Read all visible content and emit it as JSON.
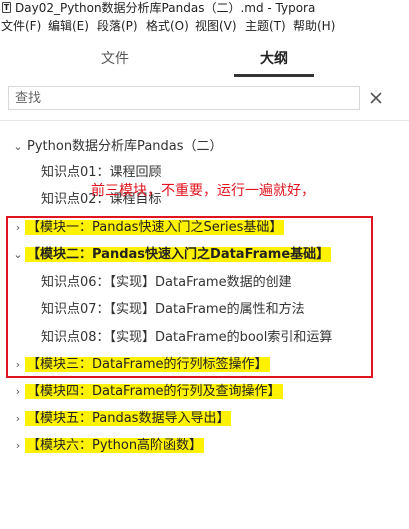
{
  "window": {
    "title": "Day02_Python数据分析库Pandas（二）.md - Typora",
    "app_icon": "T"
  },
  "menu": [
    "文件(F)",
    "编辑(E)",
    "段落(P)",
    "格式(O)",
    "视图(V)",
    "主题(T)",
    "帮助(H)"
  ],
  "tabs": {
    "files": "文件",
    "outline": "大纲"
  },
  "search": {
    "placeholder": "查找",
    "value": ""
  },
  "outline": {
    "root": "Python数据分析库Pandas（二）",
    "items": [
      {
        "label": "知识点01：课程回顾"
      },
      {
        "label": "知识点02：课程目标"
      },
      {
        "label": "【模块一：Pandas快速入门之Series基础】"
      },
      {
        "label": "【模块二：Pandas快速入门之DataFrame基础】"
      },
      {
        "label": "知识点06：【实现】DataFrame数据的创建"
      },
      {
        "label": "知识点07：【实现】DataFrame的属性和方法"
      },
      {
        "label": "知识点08：【实现】DataFrame的bool索引和运算"
      },
      {
        "label": "【模块三：DataFrame的行列标签操作】"
      },
      {
        "label": "【模块四：DataFrame的行列及查询操作】"
      },
      {
        "label": "【模块五：Pandas数据导入导出】"
      },
      {
        "label": "【模块六：Python高阶函数】"
      }
    ]
  },
  "annotation": {
    "text": "前三模块，不重要，运行一遍就好，",
    "color": "#e0141e"
  },
  "colors": {
    "highlight": "#fff200",
    "annotation": "#e0141e"
  }
}
